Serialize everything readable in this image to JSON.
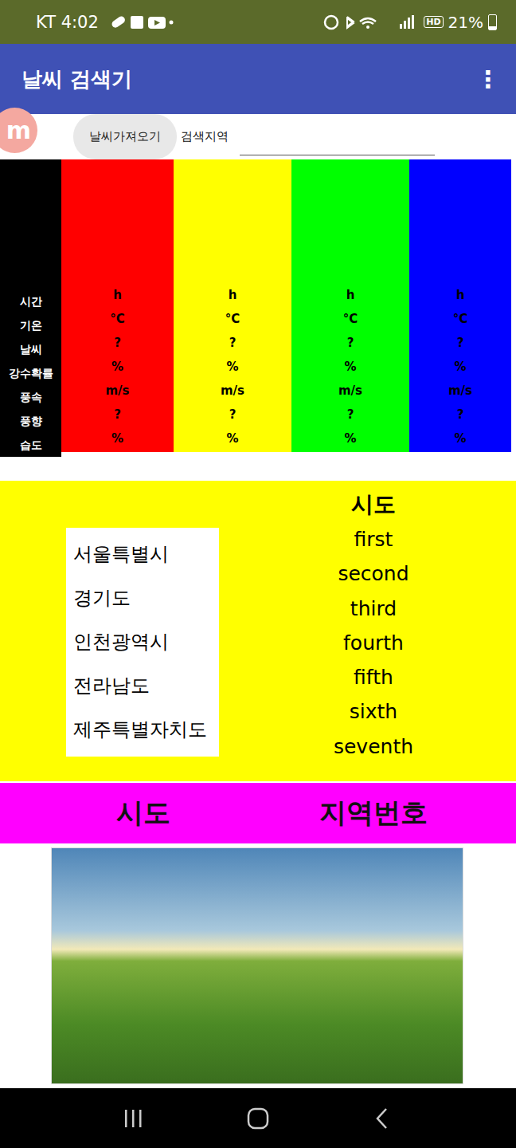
{
  "status_bar": {
    "carrier_time": "KT 4:02",
    "hd": "HD",
    "battery": "21%",
    "battery_level": 0.21
  },
  "app_bar": {
    "title": "날씨 검색기",
    "menu": "⋮"
  },
  "toolbar": {
    "logo": "m",
    "button": "날씨가져오기",
    "search_label": "검색지역",
    "search_value": ""
  },
  "weather_table": {
    "row_labels": [
      "시간",
      "기온",
      "날씨",
      "강수확률",
      "풍속",
      "풍향",
      "습도"
    ],
    "columns": [
      {
        "color": "#ff0000",
        "cells": [
          "h",
          "°C",
          "?",
          "%",
          "m/s",
          "?",
          "%"
        ]
      },
      {
        "color": "#ffff00",
        "cells": [
          "h",
          "°C",
          "?",
          "%",
          "m/s",
          "?",
          "%"
        ]
      },
      {
        "color": "#00ff00",
        "cells": [
          "h",
          "°C",
          "?",
          "%",
          "m/s",
          "?",
          "%"
        ]
      },
      {
        "color": "#0000ff",
        "cells": [
          "h",
          "°C",
          "?",
          "%",
          "m/s",
          "?",
          "%"
        ]
      }
    ]
  },
  "region_list": [
    "서울특별시",
    "경기도",
    "인천광역시",
    "전라남도",
    "제주특별자치도"
  ],
  "sido_list": {
    "header": "시도",
    "items": [
      "first",
      "second",
      "third",
      "fourth",
      "fifth",
      "sixth",
      "seventh"
    ]
  },
  "footer_headers": [
    "시도",
    "지역번호"
  ]
}
